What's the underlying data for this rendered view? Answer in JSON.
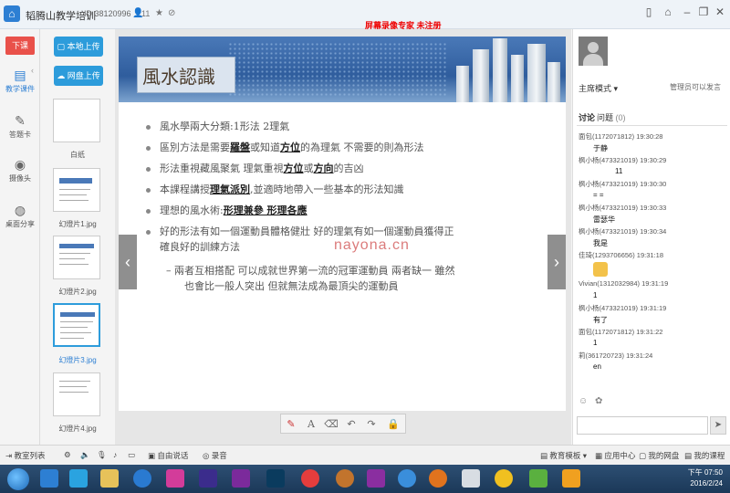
{
  "window": {
    "title": "韬腾山教学培训",
    "room_id": "ID 38120996",
    "online_count": "11",
    "trial_notice": "屏幕录像专家 未注册"
  },
  "leftnav": {
    "exit_label": "下课",
    "items": [
      {
        "label": "教学课件",
        "icon": "courseware-icon"
      },
      {
        "label": "答题卡",
        "icon": "answer-card-icon"
      },
      {
        "label": "摄像头",
        "icon": "camera-icon"
      },
      {
        "label": "桌面分享",
        "icon": "desktop-share-icon"
      }
    ]
  },
  "thumbs": {
    "local_upload": "本地上传",
    "cloud_upload": "网盘上传",
    "items": [
      "白纸",
      "幻燈片1.jpg",
      "幻燈片2.jpg",
      "幻燈片3.jpg",
      "幻燈片4.jpg"
    ]
  },
  "slide": {
    "title": "風水認識",
    "b1": "風水學兩大分類:1形法 2理氣",
    "b2_pre": "區別方法是需要",
    "b2_u1": "羅盤",
    "b2_mid": "或知道",
    "b2_u2": "方位",
    "b2_post": "的為理氣 不需要的則為形法",
    "b3_pre": "形法重視藏風聚氣  理氣重視",
    "b3_u1": "方位",
    "b3_mid": "或",
    "b3_u2": "方向",
    "b3_post": "的吉凶",
    "b4_pre": "本課程講授",
    "b4_u": "理氣派別",
    "b4_post": ",並適時地帶入一些基本的形法知識",
    "b5_pre": "理想的風水術:",
    "b5_u": "形理兼參 形理各應",
    "b6_l1": "好的形法有如一個運動員體格健壯 好的理氣有如一個運動員獲得正",
    "b6_l2": "確良好的訓練方法",
    "sub_l1": "– 兩者互相搭配 可以成就世界第一流的冠軍運動員  兩者缺一 雖然",
    "sub_l2": "也會比一般人突出 但就無法成為最頂尖的運動員"
  },
  "watermark": "nayona.cn",
  "right": {
    "mode": "主席模式",
    "admin_note": "管理员可以发言",
    "tab_discuss": "讨论",
    "tab_question": "问题",
    "question_count": "(0)",
    "messages": [
      {
        "meta": "面包(1172071812) 19:30:28",
        "text": "于静"
      },
      {
        "meta": "枫小杨(473321019) 19:30:29",
        "text": "11"
      },
      {
        "meta": "枫小杨(473321019) 19:30:30",
        "text": "= ="
      },
      {
        "meta": "枫小杨(473321019) 19:30:33",
        "text": "雷瑟华"
      },
      {
        "meta": "枫小杨(473321019) 19:30:34",
        "text": "我是"
      },
      {
        "meta": "佳琦(1293706656) 19:31:18",
        "text": ""
      },
      {
        "meta": "Vivian(1312032984) 19:31:19",
        "text": "1"
      },
      {
        "meta": "枫小杨(473321019) 19:31:19",
        "text": "有了"
      },
      {
        "meta": "面包(1172071812) 19:31:22",
        "text": "1"
      },
      {
        "meta": "莉(361720723) 19:31:24",
        "text": "en"
      }
    ]
  },
  "statusbar": {
    "class_list": "教室列表",
    "free_talk": "自由说话",
    "record": "录音",
    "template": "教育模板",
    "app_center": "应用中心",
    "my_disk": "我的网盘",
    "my_course": "我的课程"
  },
  "taskbar": {
    "time": "下午 07:50",
    "date": "2016/2/24"
  }
}
